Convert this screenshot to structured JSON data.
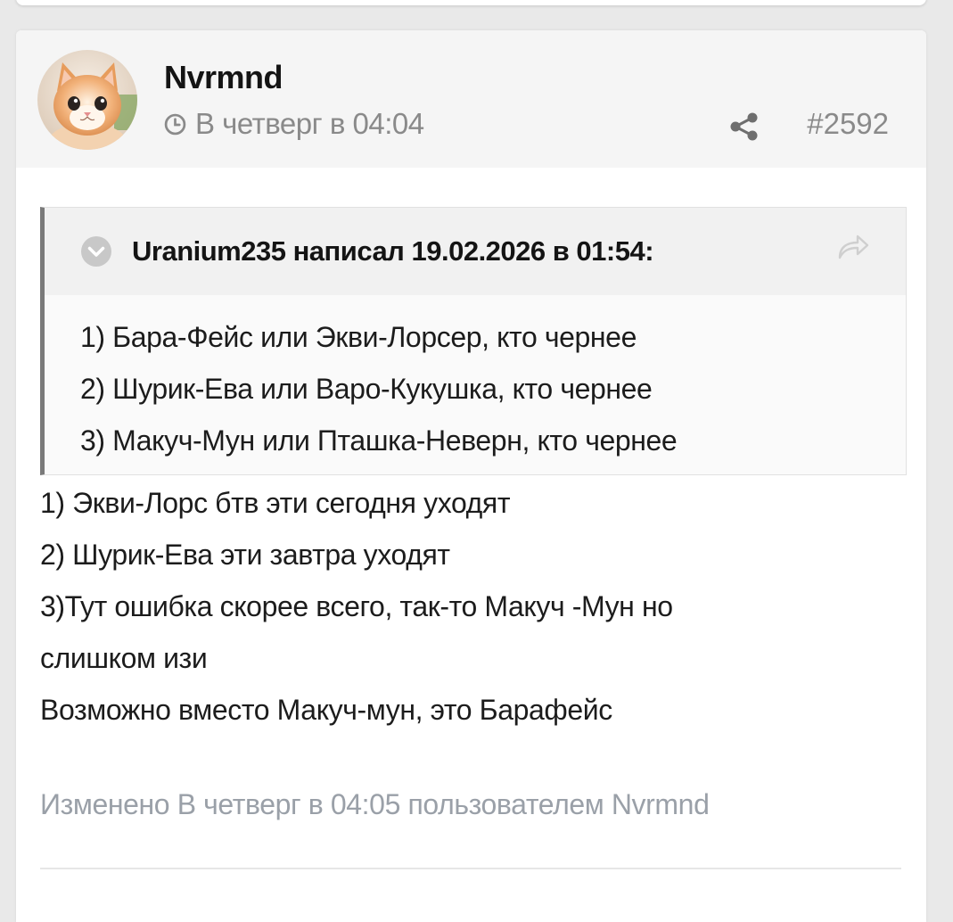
{
  "post": {
    "author": "Nvrmnd",
    "time": "В четверг в 04:04",
    "number": "#2592"
  },
  "quote": {
    "header": "Uranium235 написал 19.02.2026 в 01:54:",
    "lines": [
      "1) Бара-Фейс или Экви-Лорсер, кто чернее",
      "2) Шурик-Ева или Варо-Кукушка, кто чернее",
      "3) Макуч-Мун или Пташка-Неверн, кто чернее"
    ]
  },
  "message": {
    "lines": [
      "1) Экви-Лорс бтв эти сегодня уходят",
      "2) Шурик-Ева эти завтра уходят",
      "3)Тут ошибка скорее всего, так-то Макуч -Мун но",
      "слишком изи",
      "Возможно вместо Макуч-мун, это Барафейс"
    ]
  },
  "edited_note": "Изменено В четверг в 04:05 пользователем Nvrmnd",
  "icons": {
    "avatar": "kitten-avatar",
    "time": "clock-icon",
    "share": "share-icon",
    "expand": "chevron-down-circle-icon",
    "jump": "reply-arrow-icon"
  },
  "colors": {
    "background": "#e9e9e9",
    "card": "#ffffff",
    "header_bg": "#f5f5f5",
    "muted_text": "#8a8a8a",
    "edited_text": "#9aa0a8",
    "quote_border": "#7a7a7a"
  }
}
